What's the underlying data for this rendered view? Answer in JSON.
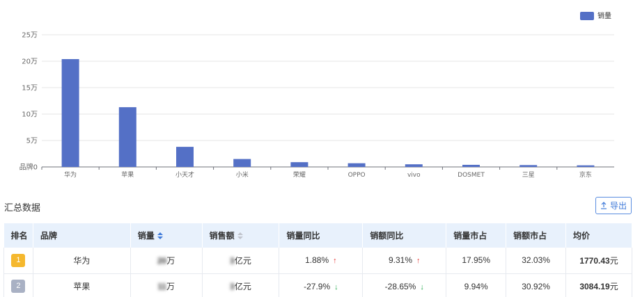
{
  "chart_data": {
    "type": "bar",
    "categories": [
      "华为",
      "苹果",
      "小天才",
      "小米",
      "荣耀",
      "OPPO",
      "vivo",
      "DOSMET",
      "三星",
      "京东"
    ],
    "series": [
      {
        "name": "销量",
        "values": [
          204000,
          113000,
          38000,
          15000,
          9000,
          7000,
          5000,
          4000,
          3500,
          3000
        ]
      }
    ],
    "yticks": [
      "25万",
      "20万",
      "15万",
      "10万",
      "5万",
      "品牌0"
    ],
    "ylim": [
      0,
      250000
    ],
    "grid": true,
    "legend_position": "top-right",
    "color": "#5470c6"
  },
  "section": {
    "title": "汇总数据"
  },
  "export": {
    "label": "导出",
    "icon": "export-icon"
  },
  "table": {
    "headers": {
      "rank": "排名",
      "brand": "品牌",
      "volume": "销量",
      "amount": "销售额",
      "vol_yoy": "销量同比",
      "amt_yoy": "销额同比",
      "vol_share": "销量市占",
      "amt_share": "销额市占",
      "avg_price": "均价"
    },
    "rows": [
      {
        "rank": "1",
        "rank_color": "#f5b82e",
        "brand": "华为",
        "volume_blur": "20",
        "volume_unit": "万",
        "amount_blur": "3",
        "amount_unit": "亿元",
        "vol_yoy": "1.88%",
        "vol_yoy_dir": "up",
        "amt_yoy": "9.31%",
        "amt_yoy_dir": "up",
        "vol_share": "17.95%",
        "amt_share": "32.03%",
        "avg_price": "1770.43",
        "price_unit": "元"
      },
      {
        "rank": "2",
        "rank_color": "#a9b1c4",
        "brand": "苹果",
        "volume_blur": "11",
        "volume_unit": "万",
        "amount_blur": "3",
        "amount_unit": "亿元",
        "vol_yoy": "-27.9%",
        "vol_yoy_dir": "down",
        "amt_yoy": "-28.65%",
        "amt_yoy_dir": "down",
        "vol_share": "9.94%",
        "amt_share": "30.92%",
        "avg_price": "3084.19",
        "price_unit": "元"
      }
    ]
  }
}
